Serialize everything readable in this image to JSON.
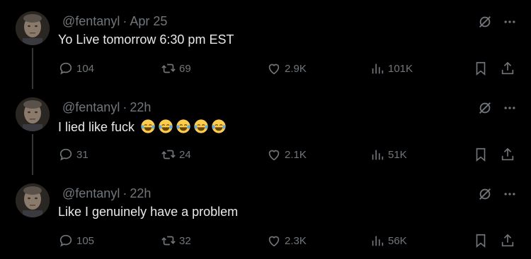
{
  "tweets": [
    {
      "handle": "@fentanyl",
      "separator": "·",
      "time": "Apr 25",
      "text": "Yo Live tomorrow 6:30 pm EST",
      "emoji_count": 0,
      "replies": "104",
      "retweets": "69",
      "likes": "2.9K",
      "views": "101K"
    },
    {
      "handle": "@fentanyl",
      "separator": "·",
      "time": "22h",
      "text": "I lied like fuck",
      "emoji_count": 5,
      "emoji_name": "tears-of-joy-emoji",
      "replies": "31",
      "retweets": "24",
      "likes": "2.1K",
      "views": "51K"
    },
    {
      "handle": "@fentanyl",
      "separator": "·",
      "time": "22h",
      "text": "Like I genuinely have a problem",
      "emoji_count": 0,
      "replies": "105",
      "retweets": "32",
      "likes": "2.3K",
      "views": "56K"
    }
  ],
  "icons": {
    "reply": "reply-icon",
    "retweet": "retweet-icon",
    "like": "heart-icon",
    "views": "views-icon",
    "bookmark": "bookmark-icon",
    "share": "share-icon",
    "grok": "grok-icon",
    "more": "more-icon"
  },
  "colors": {
    "background": "#000000",
    "text": "#e7e9ea",
    "muted": "#71767b",
    "thread_line": "#333639"
  }
}
